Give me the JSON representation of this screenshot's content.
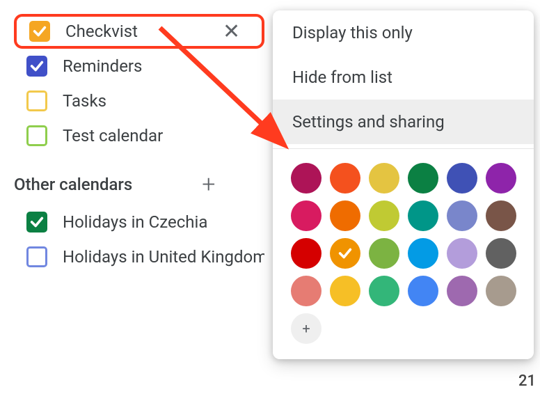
{
  "sidebar": {
    "calendars": [
      {
        "label": "Checkvist",
        "color": "#f5a623",
        "checked": true,
        "highlighted": true,
        "filled": true
      },
      {
        "label": "Reminders",
        "color": "#4050c8",
        "checked": true,
        "highlighted": false,
        "filled": true
      },
      {
        "label": "Tasks",
        "color": "#f2c94c",
        "checked": false,
        "highlighted": false,
        "filled": false
      },
      {
        "label": "Test calendar",
        "color": "#8fce4d",
        "checked": false,
        "highlighted": false,
        "filled": false
      }
    ],
    "other_section": "Other calendars",
    "other_calendars": [
      {
        "label": "Holidays in Czechia",
        "color": "#0b8043",
        "checked": true,
        "filled": true
      },
      {
        "label": "Holidays in United Kingdom",
        "color": "#7187e0",
        "checked": false,
        "filled": false
      }
    ]
  },
  "popover": {
    "items": [
      {
        "label": "Display this only",
        "hover": false
      },
      {
        "label": "Hide from list",
        "hover": false
      },
      {
        "label": "Settings and sharing",
        "hover": true
      }
    ],
    "colors": [
      "#ad1457",
      "#f4511e",
      "#e4c441",
      "#0b8043",
      "#3f51b5",
      "#8e24aa",
      "#d81b60",
      "#ef6c00",
      "#c0ca33",
      "#009688",
      "#7986cb",
      "#795548",
      "#d50000",
      "#f09300",
      "#7cb342",
      "#039be5",
      "#b39ddb",
      "#616161",
      "#e67c73",
      "#f6bf26",
      "#33b679",
      "#4285f4",
      "#9e69af",
      "#a79b8e"
    ],
    "selected_color_index": 13
  },
  "misc": {
    "corner_number": "21"
  }
}
